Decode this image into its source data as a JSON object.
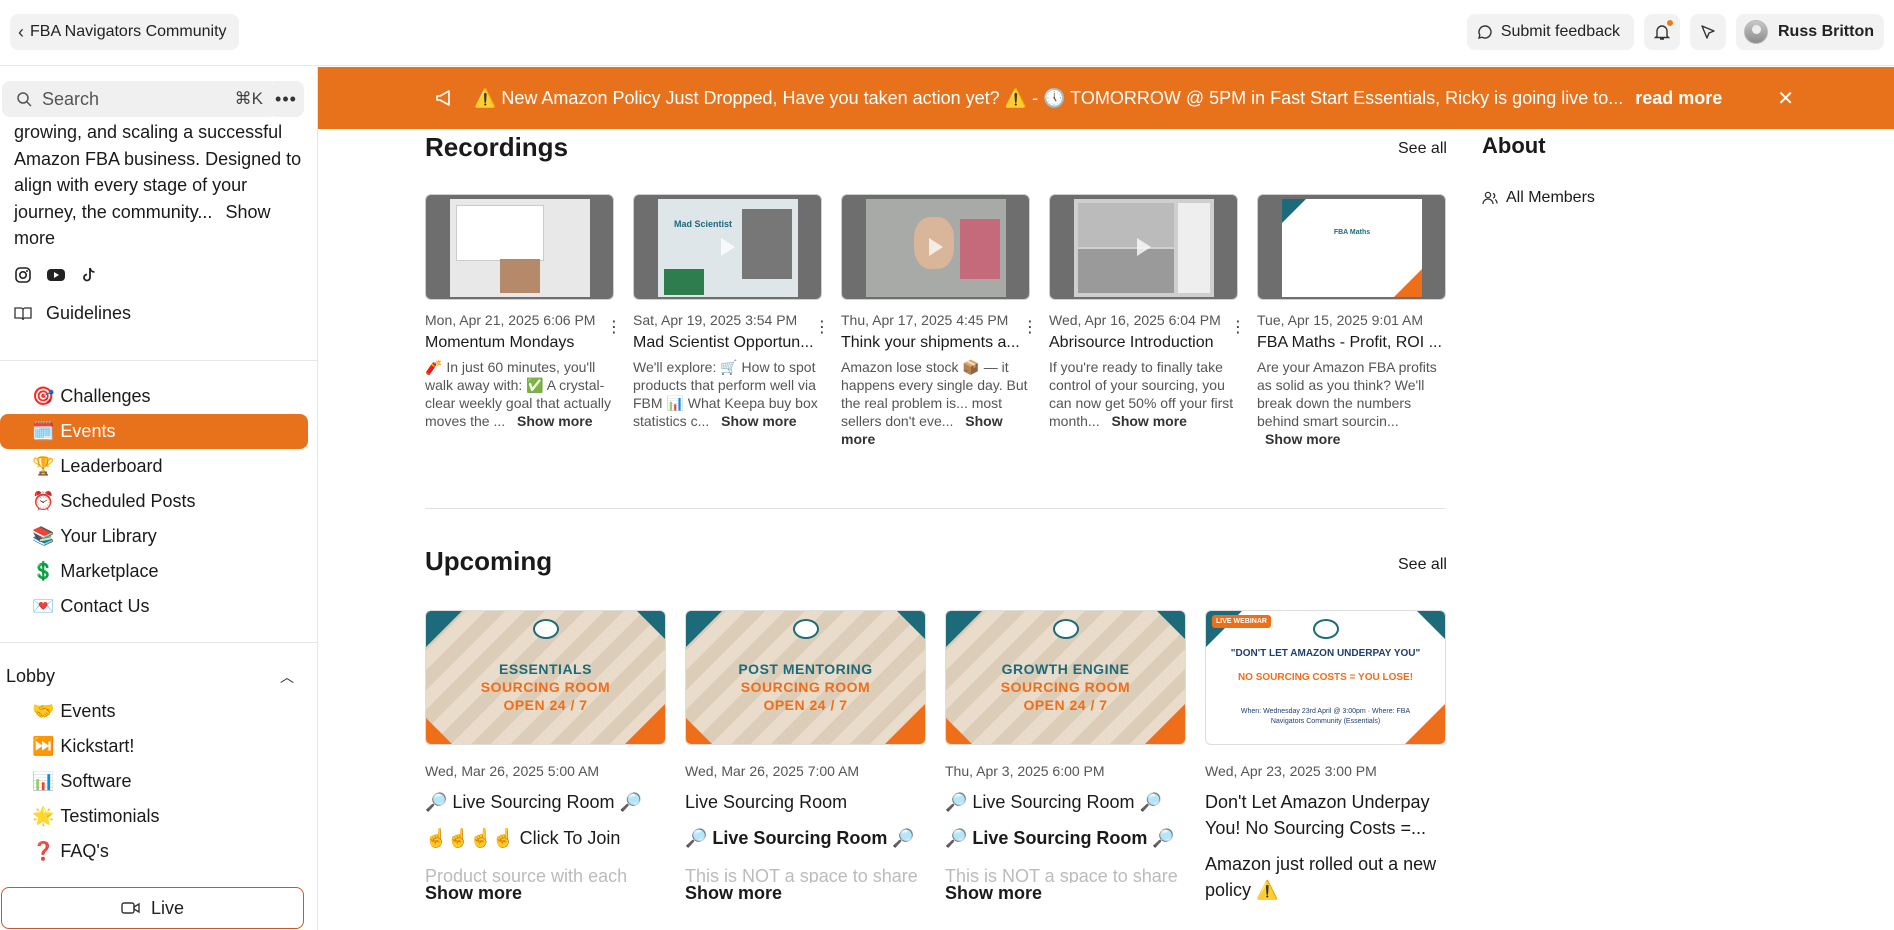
{
  "topbar": {
    "back_label": "FBA Navigators Community",
    "feedback_label": "Submit feedback",
    "user_name": "Russ Britton"
  },
  "sidebar": {
    "search_placeholder": "Search",
    "search_shortcut": "⌘K",
    "description": "growing, and scaling a successful Amazon FBA business. Designed to align with every stage of your journey, the community...",
    "show_more": "Show more",
    "guidelines": "Guidelines",
    "nav": [
      {
        "emoji": "🎯",
        "label": "Challenges",
        "active": false
      },
      {
        "emoji": "🗓️",
        "label": "Events",
        "active": true
      },
      {
        "emoji": "🏆",
        "label": "Leaderboard",
        "active": false
      },
      {
        "emoji": "⏰",
        "label": "Scheduled Posts",
        "active": false
      },
      {
        "emoji": "📚",
        "label": "Your Library",
        "active": false
      },
      {
        "emoji": "💲",
        "label": "Marketplace",
        "active": false
      },
      {
        "emoji": "💌",
        "label": "Contact Us",
        "active": false
      }
    ],
    "lobby_label": "Lobby",
    "lobby": [
      {
        "emoji": "🤝",
        "label": "Events"
      },
      {
        "emoji": "⏭️",
        "label": "Kickstart!"
      },
      {
        "emoji": "📊",
        "label": "Software"
      },
      {
        "emoji": "🌟",
        "label": "Testimonials"
      },
      {
        "emoji": "❓",
        "label": "FAQ's"
      }
    ],
    "live_label": "Live"
  },
  "banner": {
    "text": "⚠️ New Amazon Policy Just Dropped, Have you taken action yet? ⚠️ - 🕔 TOMORROW @ 5PM in Fast Start Essentials, Ricky is going live to...",
    "read_more": "read more"
  },
  "recordings": {
    "title": "Recordings",
    "see_all": "See all",
    "items": [
      {
        "date": "Mon, Apr 21, 2025 6:06 PM",
        "title": "Momentum Mondays",
        "desc": "🧨 In just 60 minutes, you'll walk away with: ✅ A crystal-clear weekly goal that actually moves the ...",
        "more": "Show more"
      },
      {
        "date": "Sat, Apr 19, 2025 3:54 PM",
        "title": "Mad Scientist Opportun...",
        "desc": "We'll explore: 🛒 How to spot products that perform well via FBM 📊 What Keepa buy box statistics c...",
        "more": "Show more"
      },
      {
        "date": "Thu, Apr 17, 2025 4:45 PM",
        "title": "Think your shipments a...",
        "desc": "Amazon lose stock 📦 — it happens every single day. But the real problem is... most sellers don't eve...",
        "more": "Show more"
      },
      {
        "date": "Wed, Apr 16, 2025 6:04 PM",
        "title": "Abrisource Introduction",
        "desc": "If you're ready to finally take control of your sourcing, you can now get 50% off your first month...",
        "more": "Show more"
      },
      {
        "date": "Tue, Apr 15, 2025 9:01 AM",
        "title": "FBA Maths - Profit, ROI ...",
        "desc": "Are your Amazon FBA profits as solid as you think? We'll break down the numbers behind smart sourcin...",
        "more": "Show more"
      }
    ]
  },
  "upcoming": {
    "title": "Upcoming",
    "see_all": "See all",
    "items": [
      {
        "date": "Wed, Mar 26, 2025 5:00 AM",
        "title": "🔎 Live Sourcing Room 🔎",
        "sub": "☝️☝️☝️☝️ Click To Join",
        "fade": "Product source with each",
        "more": "Show more",
        "img_l1": "ESSENTIALS",
        "img_l2": "SOURCING ROOM",
        "img_l3": "OPEN 24 / 7"
      },
      {
        "date": "Wed, Mar 26, 2025 7:00 AM",
        "title": "Live Sourcing Room",
        "sub": "🔎 Live Sourcing Room 🔎",
        "fade": "This is NOT a space to share",
        "more": "Show more",
        "img_l1": "POST MENTORING",
        "img_l2": "SOURCING ROOM",
        "img_l3": "OPEN 24 / 7"
      },
      {
        "date": "Thu, Apr 3, 2025 6:00 PM",
        "title": "🔎 Live Sourcing Room 🔎",
        "sub": "🔎 Live Sourcing Room 🔎",
        "fade": "This is NOT a space to share",
        "more": "Show more",
        "img_l1": "GROWTH ENGINE",
        "img_l2": "SOURCING ROOM",
        "img_l3": "OPEN 24 / 7"
      },
      {
        "date": "Wed, Apr 23, 2025 3:00 PM",
        "title": "Don't Let Amazon Underpay You! No Sourcing Costs =...",
        "sub": "Amazon just rolled out a new policy ⚠️",
        "fade": "",
        "more": "",
        "img_w1": "\"DON'T LET AMAZON UNDERPAY YOU\"",
        "img_w2": "NO SOURCING COSTS = YOU LOSE!",
        "img_w3": "When: Wednesday 23rd April @ 3:00pm · Where: FBA Navigators Community (Essentials)",
        "img_badge": "LIVE WEBINAR"
      }
    ]
  },
  "about": {
    "title": "About",
    "all_members": "All Members"
  },
  "colors": {
    "accent": "#e8721c",
    "teal": "#1d6b7a"
  }
}
